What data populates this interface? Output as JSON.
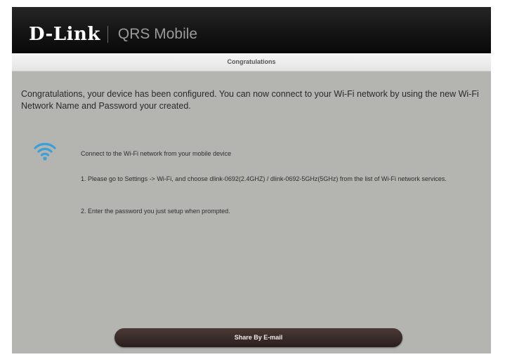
{
  "header": {
    "logo_text": "D-Link",
    "product_name": "QRS Mobile"
  },
  "titlebar": {
    "title": "Congratulations"
  },
  "main": {
    "intro": "Congratulations, your device has been configured. You can now connect to your Wi-Fi network by using the new Wi-Fi Network Name and Password your created.",
    "wifi_icon": "wifi-icon",
    "connect_instruction": "Connect to the Wi-Fi network from your mobile device",
    "step_1": "1. Please go to Settings -> Wi-Fi, and choose dlink-0692(2.4GHZ) / dlink-0692-5GHz(5GHz) from the list of Wi-Fi network services.",
    "step_2": "2. Enter the password you just setup when prompted."
  },
  "footer": {
    "share_button_label": "Share By E-mail"
  },
  "colors": {
    "header_bg": "#141414",
    "content_bg": "#b4b4b1",
    "wifi_blue": "#3aa0d8",
    "button_bg": "#2f2321"
  }
}
